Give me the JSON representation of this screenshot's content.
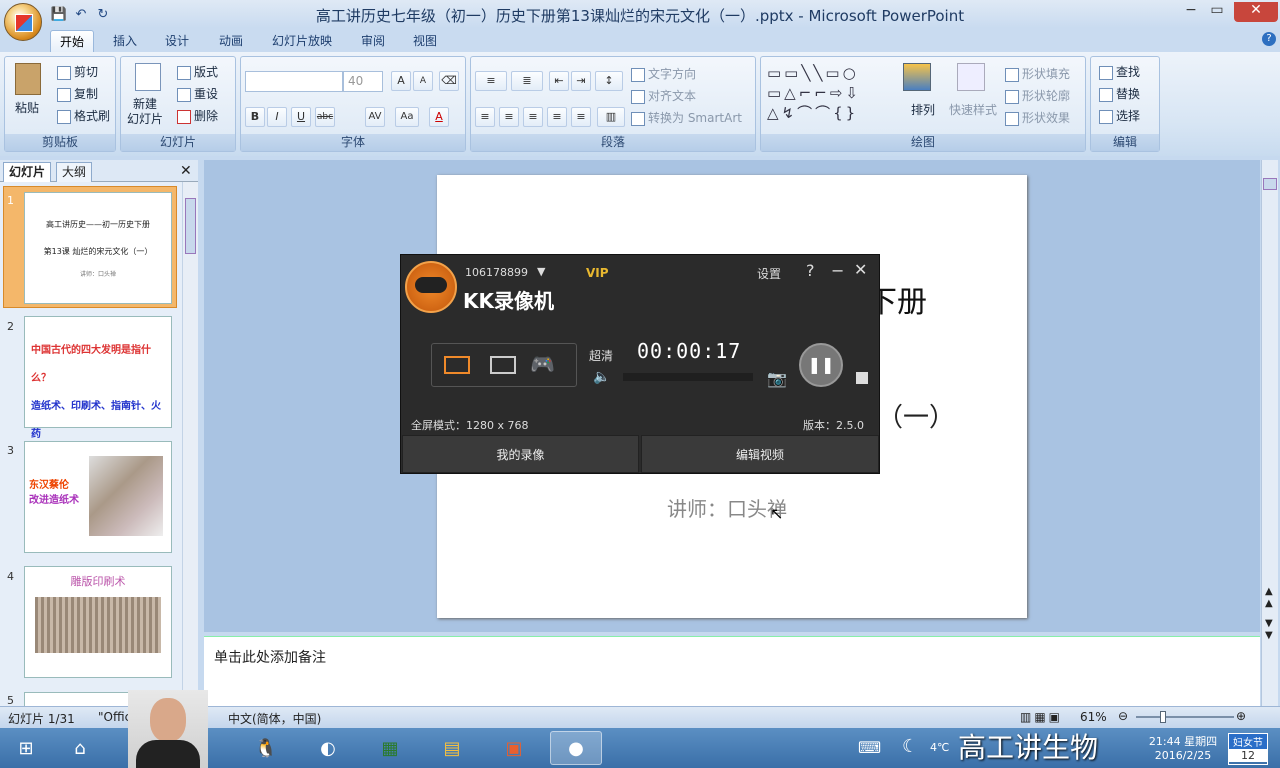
{
  "window": {
    "title": "高工讲历史七年级（初一）历史下册第13课灿烂的宋元文化（一）.pptx - Microsoft PowerPoint",
    "minimize": "−",
    "maximize": "▭",
    "close": "✕"
  },
  "qat": {
    "save": "💾",
    "undo": "↶",
    "redo": "↻"
  },
  "tabs": [
    "开始",
    "插入",
    "设计",
    "动画",
    "幻灯片放映",
    "审阅",
    "视图"
  ],
  "ribbon": {
    "clipboard": {
      "label": "剪贴板",
      "paste": "粘贴",
      "cut": "剪切",
      "copy": "复制",
      "format_painter": "格式刷"
    },
    "slides": {
      "label": "幻灯片",
      "new_slide": "新建\n幻灯片",
      "layout": "版式",
      "reset": "重设",
      "delete": "删除"
    },
    "font": {
      "label": "字体",
      "font_name": "",
      "font_size": "40",
      "bold": "B",
      "italic": "I",
      "underline": "U",
      "strike": "abc",
      "spacing": "AV",
      "case": "Aa",
      "color": "A",
      "grow": "A",
      "shrink": "A"
    },
    "paragraph": {
      "label": "段落",
      "text_direction": "文字方向",
      "align_text": "对齐文本",
      "smartart": "转换为 SmartArt"
    },
    "drawing": {
      "label": "绘图",
      "arrange": "排列",
      "quick_styles": "快速样式",
      "shape_fill": "形状填充",
      "shape_outline": "形状轮廓",
      "shape_effects": "形状效果"
    },
    "editing": {
      "label": "编辑",
      "find": "查找",
      "replace": "替换",
      "select": "选择"
    }
  },
  "pane": {
    "tab_slides": "幻灯片",
    "tab_outline": "大纲"
  },
  "thumbnails": [
    {
      "num": "1",
      "line1": "高工讲历史——初一历史下册",
      "line2": "第13课 灿烂的宋元文化（一）",
      "line3": "讲师：口头禅"
    },
    {
      "num": "2",
      "line1": "中国古代的四大发明是指什么？",
      "line2": "造纸术、印刷术、指南针、火药"
    },
    {
      "num": "3",
      "line1": "东汉蔡伦",
      "line2": "改进造纸术"
    },
    {
      "num": "4",
      "line1": "雕版印刷术"
    },
    {
      "num": "5"
    }
  ],
  "slide": {
    "title_fragment": "下册",
    "subtitle_fragment": "（一）",
    "lecturer": "讲师：口头禅"
  },
  "notes": {
    "placeholder": "单击此处添加备注"
  },
  "status": {
    "slide_info": "幻灯片 1/31",
    "theme": "\"Offic",
    "language": "中文(简体，中国)",
    "zoom": "61%"
  },
  "kk": {
    "account": "106178899",
    "vip": "VIP",
    "settings": "设置",
    "help": "?",
    "brand": "KK录像机",
    "quality": "超清",
    "timer": "00:00:17",
    "mode": "全屏模式：1280 x 768",
    "version": "版本：2.5.0",
    "my_recordings": "我的录像",
    "edit_video": "编辑视频"
  },
  "taskbar": {
    "temp": "4℃",
    "time": "21:44 星期四",
    "date": "2016/2/25",
    "festival": "妇女节",
    "festival_day": "12",
    "watermark": "高工讲生物"
  }
}
